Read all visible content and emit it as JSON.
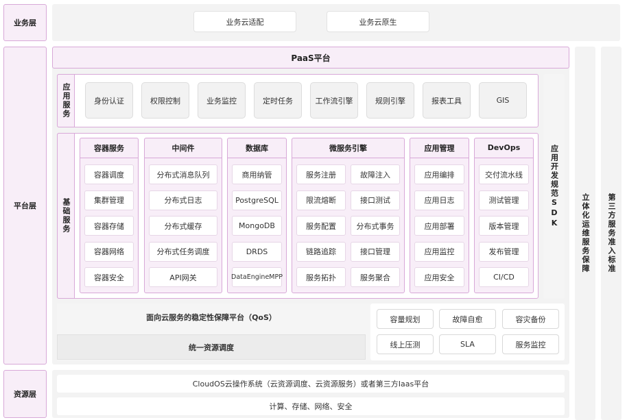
{
  "layers": {
    "business": "业务层",
    "platform": "平台层",
    "resource": "资源层"
  },
  "business_items": [
    "业务云适配",
    "业务云原生"
  ],
  "paas_title": "PaaS平台",
  "app_services": {
    "label": "应用服务",
    "items": [
      "身份认证",
      "权限控制",
      "业务监控",
      "定时任务",
      "工作流引擎",
      "规则引擎",
      "报表工具",
      "GIS"
    ]
  },
  "basic_services": {
    "label": "基础服务",
    "columns": [
      {
        "title": "容器服务",
        "items": [
          "容器调度",
          "集群管理",
          "容器存储",
          "容器网络",
          "容器安全"
        ]
      },
      {
        "title": "中间件",
        "items": [
          "分布式消息队列",
          "分布式日志",
          "分布式缓存",
          "分布式任务调度",
          "API网关"
        ]
      },
      {
        "title": "数据库",
        "items": [
          "商用纳管",
          "PostgreSQL",
          "MongoDB",
          "DRDS",
          "DataEngineMPP"
        ]
      },
      {
        "title": "微服务引擎",
        "items": [
          "服务注册",
          "故障注入",
          "限流熔断",
          "接口测试",
          "服务配置",
          "分布式事务",
          "链路追踪",
          "接口管理",
          "服务拓扑",
          "服务聚合"
        ]
      },
      {
        "title": "应用管理",
        "items": [
          "应用编排",
          "应用日志",
          "应用部署",
          "应用监控",
          "应用安全"
        ]
      },
      {
        "title": "DevOps",
        "items": [
          "交付流水线",
          "测试管理",
          "版本管理",
          "发布管理",
          "CI/CD"
        ]
      }
    ]
  },
  "sdk_label": "应用开发规范SDK",
  "ops_label": "立体化运维服务保障",
  "third_party_label": "第三方服务准入标准",
  "qos": {
    "title": "面向云服务的稳定性保障平台（QoS）",
    "items": [
      "容量规划",
      "故障自愈",
      "容灾备份",
      "线上压测",
      "SLA",
      "服务监控"
    ]
  },
  "unified_scheduling": "统一资源调度",
  "resource_bars": [
    "CloudOS云操作系统（云资源调度、云资源服务）或者第三方Iaas平台",
    "计算、存储、网络、安全"
  ]
}
